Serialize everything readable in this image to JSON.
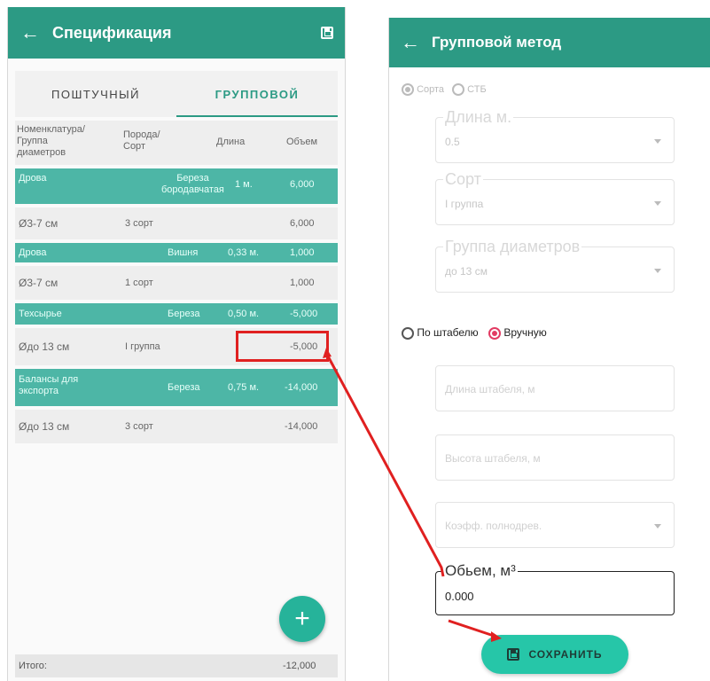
{
  "left": {
    "title": "Спецификация",
    "tabs": [
      "ПОШТУЧНЫЙ",
      "ГРУППОВОЙ"
    ],
    "columns": [
      "Номенклатура/\nГруппа\nдиаметров",
      "Порода/\nСорт",
      "Длина",
      "Объем"
    ],
    "rows": [
      {
        "name": "Дрова",
        "breed": "Береза\nбородавчатая",
        "length": "1 м.",
        "volume": "6,000"
      },
      {
        "diameter": "Ø3-7 см",
        "grade": "3 сорт",
        "volume": "6,000"
      },
      {
        "name": "Дрова",
        "breed": "Вишня",
        "length": "0,33 м.",
        "volume": "1,000"
      },
      {
        "diameter": "Ø3-7 см",
        "grade": "1 сорт",
        "volume": "1,000"
      },
      {
        "name": "Техсырье",
        "breed": "Береза",
        "length": "0,50 м.",
        "volume": "-5,000"
      },
      {
        "diameter": "Øдо 13 см",
        "grade": "I группа",
        "volume": "-5,000"
      },
      {
        "name": "Балансы для\nэкспорта",
        "breed": "Береза",
        "length": "0,75 м.",
        "volume": "-14,000"
      },
      {
        "diameter": "Øдо 13 см",
        "grade": "3 сорт",
        "volume": "-14,000"
      }
    ],
    "total_label": "Итого:",
    "total_value": "-12,000",
    "fab": "+"
  },
  "right": {
    "title": "Групповой метод",
    "radio_top": [
      "Сорта",
      "СТБ"
    ],
    "field_length": {
      "label": "Длина м.",
      "value": "0.5"
    },
    "field_grade": {
      "label": "Сорт",
      "value": "I группа"
    },
    "field_diam": {
      "label": "Группа диаметров",
      "value": "до 13 см"
    },
    "radio_mode": [
      "По штабелю",
      "Вручную"
    ],
    "ph_stack_len": "Длина штабеля, м",
    "ph_stack_h": "Высота штабеля, м",
    "ph_coef": "Коэфф. полнодрев.",
    "volume": {
      "label": "Обьем, м³",
      "value": "0.000"
    },
    "save": "СОХРАНИТЬ"
  },
  "colors": {
    "primary": "#2c9a84",
    "group_row": "#4db6a6",
    "accent": "#e23b63",
    "annotation": "#e02020"
  }
}
